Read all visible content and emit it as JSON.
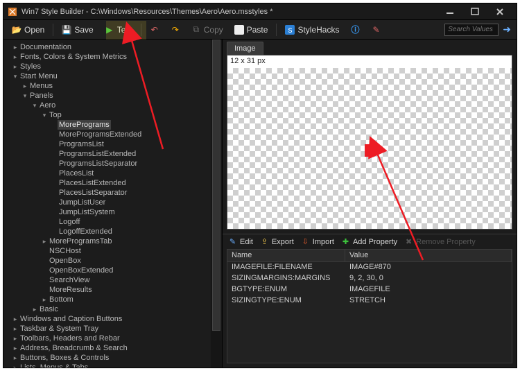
{
  "window": {
    "title": "Win7 Style Builder - C:\\Windows\\Resources\\Themes\\Aero\\Aero.msstyles *"
  },
  "toolbar": {
    "open": "Open",
    "save": "Save",
    "test": "Test",
    "copy": "Copy",
    "paste": "Paste",
    "stylehacks": "StyleHacks",
    "search_placeholder": "Search Values"
  },
  "tree": [
    {
      "d": 0,
      "t": "c",
      "l": "Documentation"
    },
    {
      "d": 0,
      "t": "c",
      "l": "Fonts, Colors & System Metrics"
    },
    {
      "d": 0,
      "t": "c",
      "l": "Styles"
    },
    {
      "d": 0,
      "t": "e",
      "l": "Start Menu"
    },
    {
      "d": 1,
      "t": "c",
      "l": "Menus"
    },
    {
      "d": 1,
      "t": "e",
      "l": "Panels"
    },
    {
      "d": 2,
      "t": "e",
      "l": "Aero"
    },
    {
      "d": 3,
      "t": "e",
      "l": "Top"
    },
    {
      "d": 4,
      "t": "n",
      "l": "MorePrograms",
      "sel": true
    },
    {
      "d": 4,
      "t": "n",
      "l": "MoreProgramsExtended"
    },
    {
      "d": 4,
      "t": "n",
      "l": "ProgramsList"
    },
    {
      "d": 4,
      "t": "n",
      "l": "ProgramsListExtended"
    },
    {
      "d": 4,
      "t": "n",
      "l": "ProgramsListSeparator"
    },
    {
      "d": 4,
      "t": "n",
      "l": "PlacesList"
    },
    {
      "d": 4,
      "t": "n",
      "l": "PlacesListExtended"
    },
    {
      "d": 4,
      "t": "n",
      "l": "PlacesListSeparator"
    },
    {
      "d": 4,
      "t": "n",
      "l": "JumpListUser"
    },
    {
      "d": 4,
      "t": "n",
      "l": "JumpListSystem"
    },
    {
      "d": 4,
      "t": "n",
      "l": "Logoff"
    },
    {
      "d": 4,
      "t": "n",
      "l": "LogoffExtended"
    },
    {
      "d": 3,
      "t": "c",
      "l": "MoreProgramsTab"
    },
    {
      "d": 3,
      "t": "n",
      "l": "NSCHost"
    },
    {
      "d": 3,
      "t": "n",
      "l": "OpenBox"
    },
    {
      "d": 3,
      "t": "n",
      "l": "OpenBoxExtended"
    },
    {
      "d": 3,
      "t": "n",
      "l": "SearchView"
    },
    {
      "d": 3,
      "t": "n",
      "l": "MoreResults"
    },
    {
      "d": 3,
      "t": "c",
      "l": "Bottom"
    },
    {
      "d": 2,
      "t": "c",
      "l": "Basic"
    },
    {
      "d": 0,
      "t": "c",
      "l": "Windows and Caption Buttons"
    },
    {
      "d": 0,
      "t": "c",
      "l": "Taskbar & System Tray"
    },
    {
      "d": 0,
      "t": "c",
      "l": "Toolbars, Headers and Rebar"
    },
    {
      "d": 0,
      "t": "c",
      "l": "Address, Breadcrumb & Search"
    },
    {
      "d": 0,
      "t": "c",
      "l": "Buttons, Boxes & Controls"
    },
    {
      "d": 0,
      "t": "c",
      "l": "Lists, Menus & Tabs"
    }
  ],
  "image_panel": {
    "tab": "Image",
    "size_label": "12 x 31 px"
  },
  "prop_toolbar": {
    "edit": "Edit",
    "export": "Export",
    "import": "Import",
    "add": "Add Property",
    "remove": "Remove Property"
  },
  "prop_grid": {
    "headers": {
      "name": "Name",
      "value": "Value"
    },
    "rows": [
      {
        "name": "IMAGEFILE:FILENAME",
        "value": "IMAGE#870"
      },
      {
        "name": "SIZINGMARGINS:MARGINS",
        "value": "9, 2, 30, 0"
      },
      {
        "name": "BGTYPE:ENUM",
        "value": "IMAGEFILE"
      },
      {
        "name": "SIZINGTYPE:ENUM",
        "value": "STRETCH"
      }
    ]
  }
}
